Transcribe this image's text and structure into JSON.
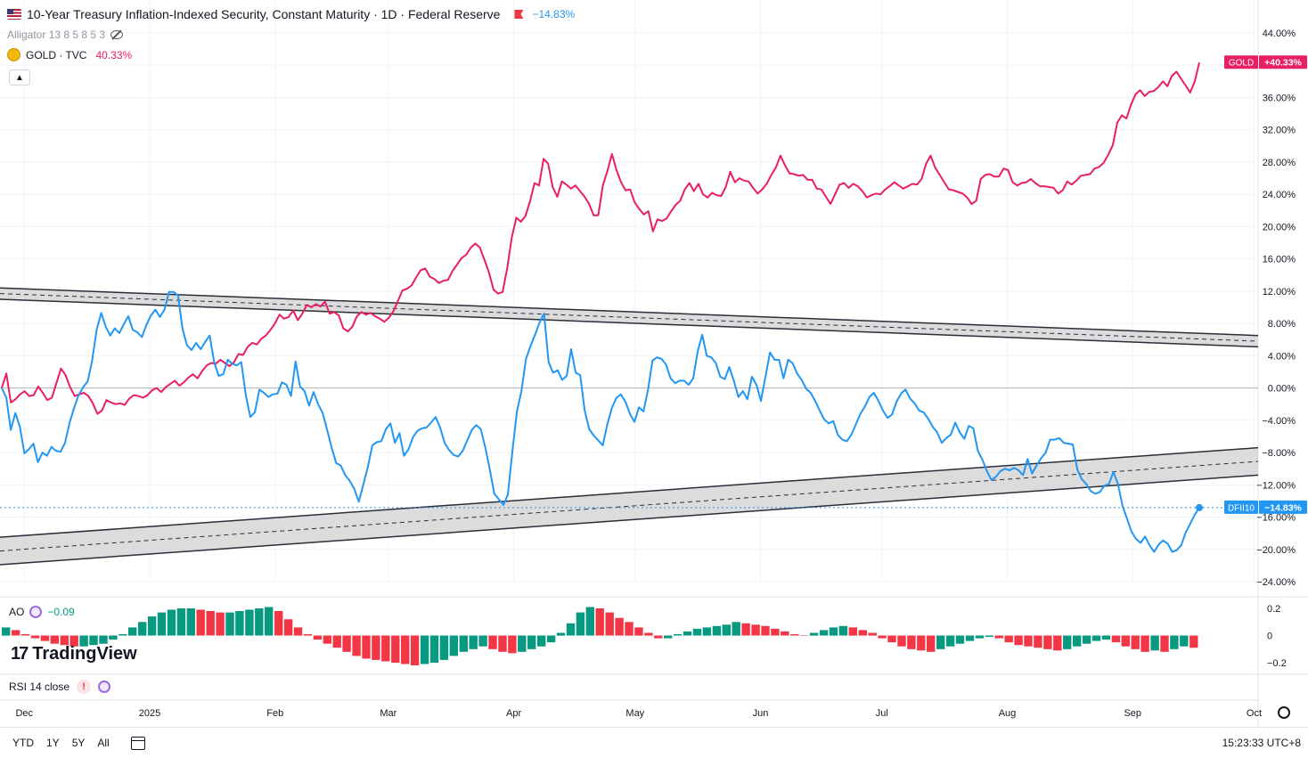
{
  "header": {
    "title": "10-Year Treasury Inflation-Indexed Security, Constant Maturity · 1D · Federal Reserve",
    "change": "−14.83%",
    "alligator_label": "Alligator 13 8 5 8 5 3",
    "gold_symbol": "GOLD · TVC",
    "gold_change": "40.33%"
  },
  "indicators": {
    "ao_label": "AO",
    "ao_value": "−0.09",
    "rsi_label": "RSI 14 close",
    "rsi_warning": "!"
  },
  "branding": {
    "logo_mark": "17",
    "logo_text": "TradingView"
  },
  "bottom_bar": {
    "ranges": [
      "YTD",
      "1Y",
      "5Y",
      "All"
    ],
    "clock": "15:23:33 UTC+8"
  },
  "colors": {
    "gold": "#e91e63",
    "dfii": "#2196f3",
    "ao_up": "#089981",
    "ao_down": "#f23645",
    "channel_fill": "#d6d6d6"
  },
  "chart_data": {
    "type": "line",
    "x_axis": {
      "tick_labels": [
        "Dec",
        "2025",
        "Feb",
        "Mar",
        "Apr",
        "May",
        "Jun",
        "Jul",
        "Aug",
        "Sep",
        "Oct"
      ],
      "range": [
        "2024-11-25",
        "2025-10-02"
      ]
    },
    "y_axis": {
      "unit": "%",
      "range": [
        -26,
        46
      ],
      "tick_labels": [
        "44.00%",
        "40.00%",
        "36.00%",
        "32.00%",
        "28.00%",
        "24.00%",
        "20.00%",
        "16.00%",
        "12.00%",
        "8.00%",
        "4.00%",
        "0.00%",
        "−4.00%",
        "−8.00%",
        "−12.00%",
        "−16.00%",
        "−20.00%",
        "−24.00%"
      ],
      "tick_values": [
        44,
        40,
        36,
        32,
        28,
        24,
        20,
        16,
        12,
        8,
        4,
        0,
        -4,
        -8,
        -12,
        -16,
        -20,
        -24
      ]
    },
    "series": [
      {
        "name": "GOLD",
        "last_label": "+40.33%",
        "values": [
          0.0,
          1.8,
          -1.8,
          -1.4,
          -0.8,
          -0.4,
          -1.0,
          -0.9,
          0.2,
          -0.6,
          -1.5,
          -1.2,
          0.6,
          2.4,
          1.6,
          0.1,
          -1.0,
          -0.8,
          -0.6,
          -1.0,
          -1.9,
          -3.2,
          -2.8,
          -1.5,
          -1.8,
          -2.0,
          -1.9,
          -2.1,
          -1.3,
          -0.9,
          -1.0,
          -1.2,
          -0.9,
          -0.3,
          0.0,
          -0.5,
          0.1,
          0.5,
          0.9,
          0.3,
          0.7,
          1.3,
          1.7,
          1.2,
          2.1,
          2.8,
          3.1,
          3.0,
          3.5,
          3.1,
          2.7,
          3.2,
          4.2,
          4.1,
          5.1,
          5.6,
          5.4,
          6.1,
          6.5,
          7.2,
          8.0,
          9.1,
          8.6,
          8.8,
          9.6,
          8.4,
          9.2,
          10.3,
          10.0,
          10.4,
          10.1,
          10.7,
          9.2,
          9.4,
          9.0,
          7.4,
          7.0,
          7.6,
          8.9,
          9.4,
          9.1,
          9.3,
          8.9,
          8.6,
          8.2,
          8.7,
          9.5,
          10.8,
          12.1,
          12.3,
          12.7,
          13.7,
          14.6,
          14.8,
          13.8,
          13.5,
          13.0,
          13.3,
          13.4,
          14.5,
          15.3,
          16.1,
          16.5,
          17.4,
          17.9,
          17.4,
          15.9,
          14.3,
          12.2,
          11.7,
          11.9,
          14.8,
          18.6,
          21.1,
          20.6,
          21.3,
          23.1,
          25.4,
          25.1,
          28.4,
          27.8,
          24.9,
          23.7,
          25.6,
          25.2,
          24.7,
          25.1,
          24.4,
          23.7,
          22.8,
          21.4,
          21.4,
          25.1,
          26.9,
          29.0,
          27.0,
          25.5,
          24.5,
          24.6,
          23.0,
          22.2,
          21.5,
          21.9,
          19.4,
          20.9,
          20.7,
          21.0,
          21.9,
          22.7,
          23.2,
          24.6,
          25.4,
          24.4,
          25.3,
          24.0,
          23.6,
          24.2,
          23.9,
          23.8,
          24.9,
          26.8,
          25.5,
          26.0,
          25.7,
          25.6,
          24.8,
          24.1,
          24.6,
          25.3,
          26.4,
          27.3,
          28.8,
          27.6,
          26.6,
          26.5,
          26.3,
          26.4,
          25.8,
          25.8,
          24.7,
          24.6,
          23.7,
          22.8,
          24.0,
          25.2,
          25.4,
          24.8,
          25.3,
          25.0,
          24.4,
          23.6,
          23.9,
          24.1,
          24.0,
          24.6,
          25.0,
          25.5,
          25.1,
          24.7,
          25.0,
          25.3,
          25.2,
          25.9,
          27.8,
          28.8,
          27.3,
          26.4,
          25.5,
          24.6,
          24.5,
          24.3,
          24.1,
          23.6,
          22.8,
          23.2,
          25.9,
          26.4,
          26.5,
          26.2,
          26.2,
          27.2,
          27.0,
          25.5,
          25.1,
          25.4,
          25.5,
          25.9,
          25.4,
          25.0,
          25.0,
          24.9,
          24.8,
          24.1,
          24.5,
          25.6,
          25.2,
          25.7,
          26.3,
          26.4,
          26.5,
          27.2,
          27.4,
          27.9,
          28.9,
          30.1,
          32.9,
          33.8,
          33.4,
          35.1,
          36.4,
          36.9,
          36.2,
          36.7,
          36.8,
          37.3,
          38.0,
          37.4,
          38.7,
          39.2,
          38.3,
          37.5,
          36.6,
          38.0,
          40.33
        ]
      },
      {
        "name": "DFII10",
        "last_label": "−14.83%",
        "values": [
          0.0,
          -1.2,
          -5.2,
          -3.1,
          -4.8,
          -8.1,
          -7.6,
          -6.9,
          -9.2,
          -8.0,
          -8.4,
          -7.3,
          -7.8,
          -7.9,
          -6.8,
          -4.3,
          -2.5,
          -0.9,
          0.1,
          0.8,
          3.4,
          7.2,
          9.3,
          7.6,
          6.5,
          7.4,
          6.8,
          7.9,
          8.9,
          7.2,
          6.9,
          6.3,
          7.8,
          9.0,
          9.7,
          8.8,
          9.7,
          11.9,
          11.9,
          11.5,
          7.3,
          5.3,
          4.7,
          5.6,
          4.8,
          5.7,
          6.5,
          3.2,
          1.5,
          1.7,
          3.5,
          3.0,
          2.8,
          3.2,
          -0.9,
          -3.6,
          -3.0,
          -0.2,
          -0.6,
          -1.1,
          -0.8,
          -0.7,
          0.7,
          0.4,
          -1.0,
          3.3,
          0.2,
          -0.4,
          -2.2,
          -0.5,
          -2.0,
          -3.1,
          -5.2,
          -7.4,
          -9.3,
          -9.6,
          -10.8,
          -11.5,
          -12.5,
          -14.1,
          -12.0,
          -9.8,
          -7.1,
          -6.7,
          -6.6,
          -5.1,
          -4.4,
          -6.8,
          -5.6,
          -8.4,
          -7.6,
          -6.1,
          -5.3,
          -5.0,
          -4.9,
          -4.3,
          -3.6,
          -4.9,
          -6.8,
          -7.7,
          -8.3,
          -8.5,
          -7.8,
          -6.5,
          -5.2,
          -4.6,
          -5.1,
          -7.4,
          -10.1,
          -13.1,
          -13.8,
          -14.5,
          -13.2,
          -7.8,
          -2.9,
          -0.4,
          3.6,
          5.2,
          6.6,
          8.1,
          9.2,
          3.2,
          1.9,
          2.2,
          1.0,
          1.5,
          4.8,
          1.9,
          1.6,
          -2.8,
          -5.1,
          -5.9,
          -6.5,
          -7.1,
          -4.5,
          -2.5,
          -1.2,
          -0.8,
          -1.7,
          -3.2,
          -4.2,
          -2.4,
          -2.9,
          -0.2,
          3.4,
          3.8,
          3.6,
          2.9,
          1.2,
          0.6,
          0.9,
          0.9,
          0.4,
          1.2,
          4.5,
          6.6,
          4.0,
          3.8,
          3.1,
          1.4,
          1.1,
          2.6,
          0.9,
          -1.1,
          -0.4,
          -1.4,
          1.4,
          0.4,
          -1.6,
          1.4,
          4.4,
          3.5,
          3.5,
          1.2,
          3.5,
          3.1,
          1.8,
          1.0,
          -0.1,
          -0.6,
          -1.6,
          -2.8,
          -3.9,
          -4.4,
          -4.1,
          -5.8,
          -6.4,
          -6.6,
          -5.8,
          -4.5,
          -3.2,
          -2.3,
          -1.1,
          -0.6,
          -1.6,
          -2.8,
          -3.7,
          -3.3,
          -1.7,
          -0.7,
          -0.2,
          -1.3,
          -1.9,
          -2.8,
          -3.0,
          -3.8,
          -4.8,
          -5.5,
          -6.8,
          -6.2,
          -5.8,
          -4.3,
          -5.5,
          -6.3,
          -4.7,
          -5.0,
          -7.8,
          -8.9,
          -10.3,
          -11.4,
          -11.0,
          -10.3,
          -10.0,
          -10.2,
          -9.9,
          -10.2,
          -10.8,
          -8.8,
          -10.6,
          -9.6,
          -8.7,
          -8.0,
          -6.4,
          -6.4,
          -6.2,
          -6.8,
          -6.9,
          -7.0,
          -10.1,
          -11.3,
          -11.9,
          -12.8,
          -13.1,
          -12.9,
          -12.1,
          -11.9,
          -10.4,
          -11.9,
          -14.6,
          -16.2,
          -17.8,
          -18.7,
          -19.2,
          -18.4,
          -19.5,
          -20.3,
          -19.4,
          -18.9,
          -19.3,
          -20.3,
          -20.1,
          -19.5,
          -17.9,
          -16.8,
          -15.7,
          -14.83
        ]
      }
    ],
    "channels": [
      {
        "name": "upper",
        "start_center": 11.7,
        "end_center": 5.8,
        "half_width": 0.7
      },
      {
        "name": "lower",
        "start_center": -20.2,
        "end_center": -9.1,
        "half_width": 1.7
      }
    ],
    "ao": {
      "y_tick_labels": [
        "0.2",
        "0",
        "−0.2"
      ],
      "y_tick_values": [
        0.2,
        0,
        -0.2
      ],
      "values": [
        0.06,
        0.04,
        0.01,
        -0.02,
        -0.04,
        -0.06,
        -0.07,
        -0.08,
        -0.08,
        -0.07,
        -0.06,
        -0.03,
        0.01,
        0.06,
        0.1,
        0.14,
        0.17,
        0.19,
        0.2,
        0.2,
        0.19,
        0.18,
        0.17,
        0.17,
        0.18,
        0.19,
        0.2,
        0.21,
        0.18,
        0.12,
        0.06,
        0.01,
        -0.03,
        -0.06,
        -0.09,
        -0.12,
        -0.15,
        -0.17,
        -0.18,
        -0.19,
        -0.2,
        -0.21,
        -0.22,
        -0.21,
        -0.2,
        -0.18,
        -0.15,
        -0.12,
        -0.1,
        -0.08,
        -0.1,
        -0.12,
        -0.13,
        -0.12,
        -0.1,
        -0.08,
        -0.05,
        0.02,
        0.09,
        0.17,
        0.21,
        0.2,
        0.17,
        0.13,
        0.1,
        0.06,
        0.02,
        -0.02,
        -0.02,
        0.01,
        0.03,
        0.05,
        0.06,
        0.07,
        0.08,
        0.1,
        0.09,
        0.08,
        0.07,
        0.05,
        0.03,
        0.01,
        0.0,
        0.02,
        0.04,
        0.06,
        0.07,
        0.06,
        0.04,
        0.02,
        -0.02,
        -0.05,
        -0.08,
        -0.1,
        -0.11,
        -0.12,
        -0.1,
        -0.08,
        -0.06,
        -0.04,
        -0.02,
        -0.01,
        -0.02,
        -0.05,
        -0.07,
        -0.08,
        -0.09,
        -0.1,
        -0.11,
        -0.1,
        -0.08,
        -0.06,
        -0.04,
        -0.03,
        -0.05,
        -0.08,
        -0.1,
        -0.12,
        -0.11,
        -0.12,
        -0.1,
        -0.08,
        -0.09
      ]
    }
  }
}
